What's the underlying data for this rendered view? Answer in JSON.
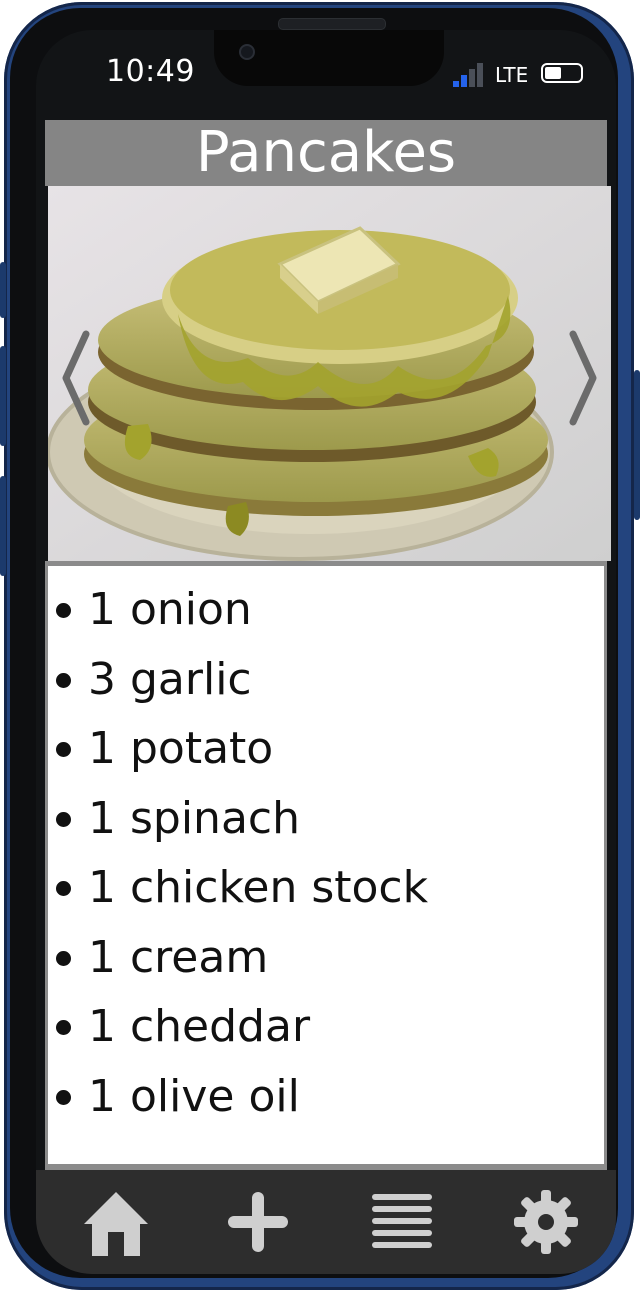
{
  "status_bar": {
    "time": "10:49",
    "network": "LTE",
    "signal_bars_active": 2,
    "signal_bars_total": 4
  },
  "recipe": {
    "title": "Pancakes",
    "photo_icon": "pancake-stack-photo",
    "ingredients": [
      "1 onion",
      "3 garlic",
      "1 potato",
      "1 spinach",
      "1 chicken stock",
      "1 cream",
      "1 cheddar",
      "1 olive oil"
    ]
  },
  "carousel": {
    "prev_icon": "chevron-left-icon",
    "next_icon": "chevron-right-icon"
  },
  "tab_bar": {
    "items": [
      {
        "icon": "home-icon"
      },
      {
        "icon": "plus-icon"
      },
      {
        "icon": "list-icon"
      },
      {
        "icon": "gear-icon"
      }
    ]
  },
  "colors": {
    "frame": "#23447e",
    "title_bar": "#858585",
    "tab_bar": "#2d2d2d",
    "tab_icon": "#cfcfcf",
    "signal_active": "#2563eb"
  }
}
